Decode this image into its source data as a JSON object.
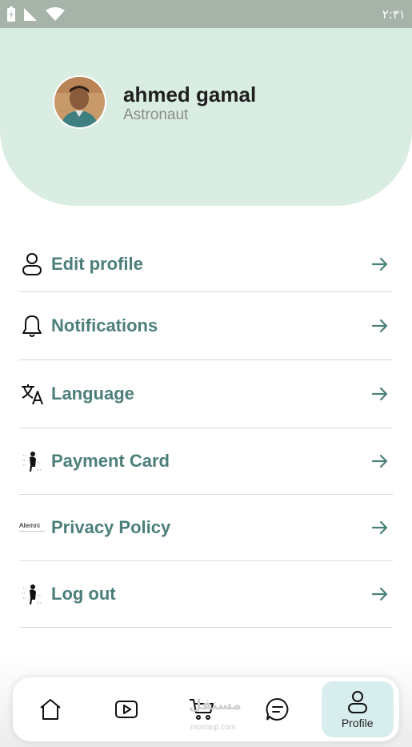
{
  "status_bar": {
    "time": "٢:٣١",
    "icons": [
      "battery-charging-icon",
      "signal-icon",
      "wifi-icon"
    ]
  },
  "profile": {
    "name": "ahmed gamal",
    "role": "Astronaut"
  },
  "menu": {
    "items": [
      {
        "label": "Edit profile",
        "icon": "user-icon"
      },
      {
        "label": "Notifications",
        "icon": "bell-icon"
      },
      {
        "label": "Language",
        "icon": "translate-icon"
      },
      {
        "label": "Payment Card",
        "icon": "figure-image-icon"
      },
      {
        "label": "Privacy Policy",
        "icon": "alemni-logo-icon",
        "icon_text": "Alemni"
      },
      {
        "label": "Log out",
        "icon": "figure-image-icon"
      }
    ]
  },
  "bottom_nav": {
    "items": [
      {
        "icon": "home-icon"
      },
      {
        "icon": "play-icon"
      },
      {
        "icon": "cart-icon"
      },
      {
        "icon": "chat-icon"
      },
      {
        "icon": "user-icon",
        "label": "Profile",
        "active": true
      }
    ]
  },
  "watermark": {
    "text": "مستقل",
    "sub": "mostaql.com"
  },
  "colors": {
    "header_bg": "#d9ede2",
    "status_bg": "#a6b3a9",
    "label_color": "#4c7f7b",
    "active_tab_bg": "#d8eeee"
  }
}
